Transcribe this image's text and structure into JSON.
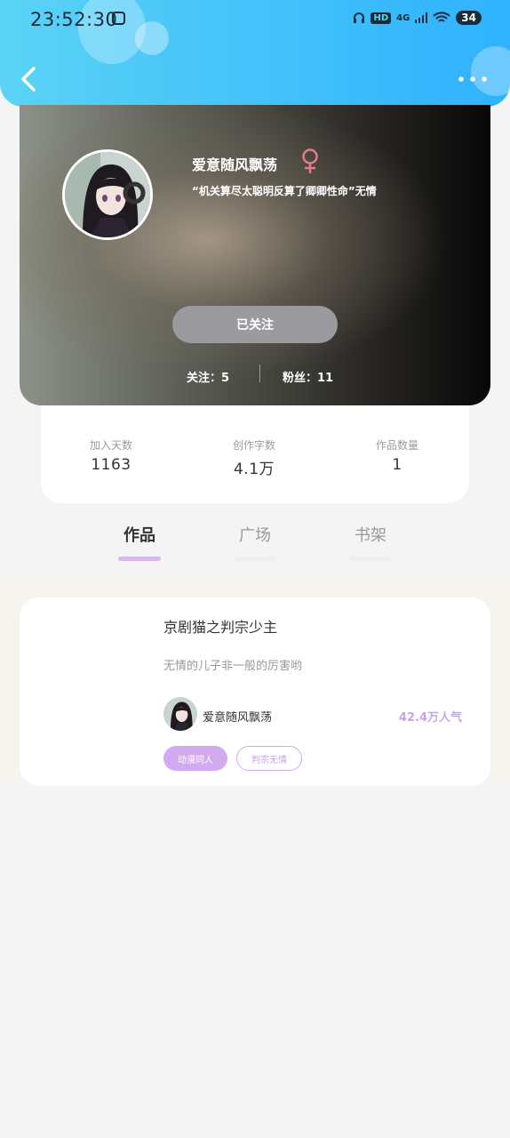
{
  "status_bar": {
    "time": "23:52:30",
    "hd": "HD",
    "network": "4G",
    "battery": "34"
  },
  "header": {
    "back_icon": "chevron-left-icon",
    "more_icon": "more-dots-icon"
  },
  "profile": {
    "username": "爱意随风飘荡",
    "gender_icon": "female-icon",
    "gender_color": "#e87a8c",
    "bio": "“机关算尽太聪明反算了卿卿性命”无情",
    "follow_button": "已关注",
    "following_label": "关注：",
    "following_count": "5",
    "fans_label": "粉丝：",
    "fans_count": "11"
  },
  "stats": [
    {
      "label": "加入天数",
      "value": "1163"
    },
    {
      "label": "创作字数",
      "value": "4.1万"
    },
    {
      "label": "作品数量",
      "value": "1"
    }
  ],
  "tabs": [
    {
      "label": "作品",
      "active": true
    },
    {
      "label": "广场",
      "active": false
    },
    {
      "label": "书架",
      "active": false
    }
  ],
  "works": [
    {
      "title": "京剧猫之判宗少主",
      "description": "无情的儿子非一般的厉害哟",
      "author": "爱意随风飘荡",
      "popularity": "42.4万人气",
      "tags": [
        "动漫同人",
        "判宗无情"
      ]
    }
  ],
  "colors": {
    "accent": "#d2aaf0",
    "header_start": "#5ad3f5",
    "header_end": "#2fb2ff"
  }
}
